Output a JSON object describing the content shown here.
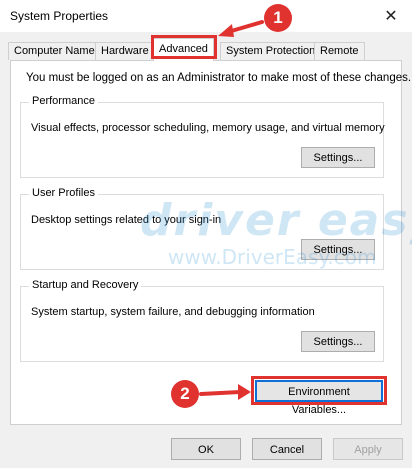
{
  "window": {
    "title": "System Properties",
    "close_icon": "close-icon"
  },
  "tabs": [
    {
      "label": "Computer Name"
    },
    {
      "label": "Hardware"
    },
    {
      "label": "Advanced",
      "active": true
    },
    {
      "label": "System Protection"
    },
    {
      "label": "Remote"
    }
  ],
  "admin_note": "You must be logged on as an Administrator to make most of these changes.",
  "groups": {
    "performance": {
      "title": "Performance",
      "description": "Visual effects, processor scheduling, memory usage, and virtual memory",
      "button": "Settings..."
    },
    "user_profiles": {
      "title": "User Profiles",
      "description": "Desktop settings related to your sign-in",
      "button": "Settings..."
    },
    "startup_recovery": {
      "title": "Startup and Recovery",
      "description": "System startup, system failure, and debugging information",
      "button": "Settings..."
    }
  },
  "environment_button": "Environment Variables...",
  "footer": {
    "ok": "OK",
    "cancel": "Cancel",
    "apply": "Apply"
  },
  "annotations": {
    "step1": "1",
    "step2": "2",
    "highlight_color": "#e0322f"
  },
  "watermark": {
    "brand": "driver easy",
    "url": "www.DriverEasy.com"
  }
}
